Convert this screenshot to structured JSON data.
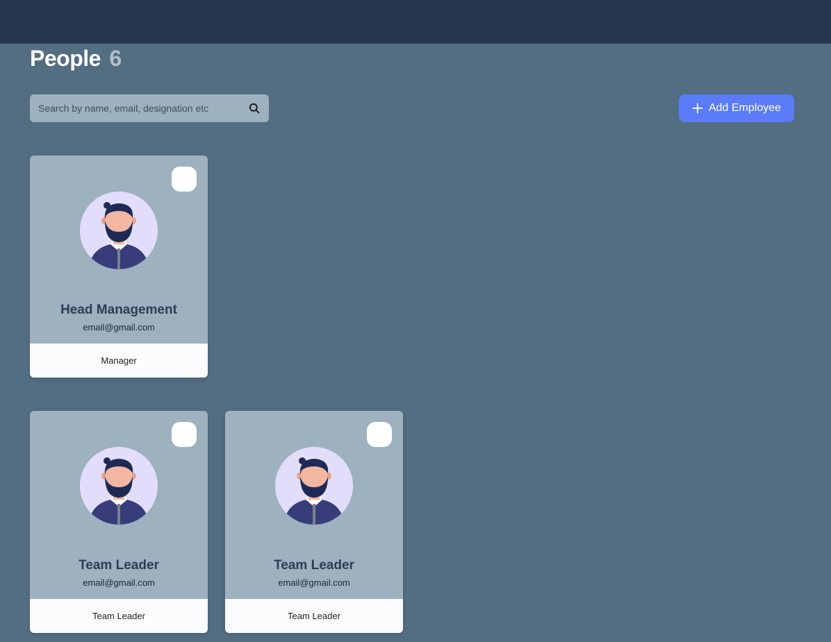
{
  "page": {
    "title": "People",
    "count": "6"
  },
  "search": {
    "placeholder": "Search by name, email, designation etc",
    "value": ""
  },
  "actions": {
    "add_label": "Add Employee"
  },
  "colors": {
    "accent": "#5a7cf6",
    "topbar": "#263750",
    "background": "#536d82",
    "card": "#9db1be"
  },
  "cards": [
    {
      "name": "Head Management",
      "email": "email@gmail.com",
      "role": "Manager",
      "avatar": "male-avatar-icon"
    },
    {
      "name": "Team Leader",
      "email": "email@gmail.com",
      "role": "Team Leader",
      "avatar": "male-avatar-icon"
    },
    {
      "name": "Team Leader",
      "email": "email@gmail.com",
      "role": "Team Leader",
      "avatar": "male-avatar-icon"
    }
  ]
}
